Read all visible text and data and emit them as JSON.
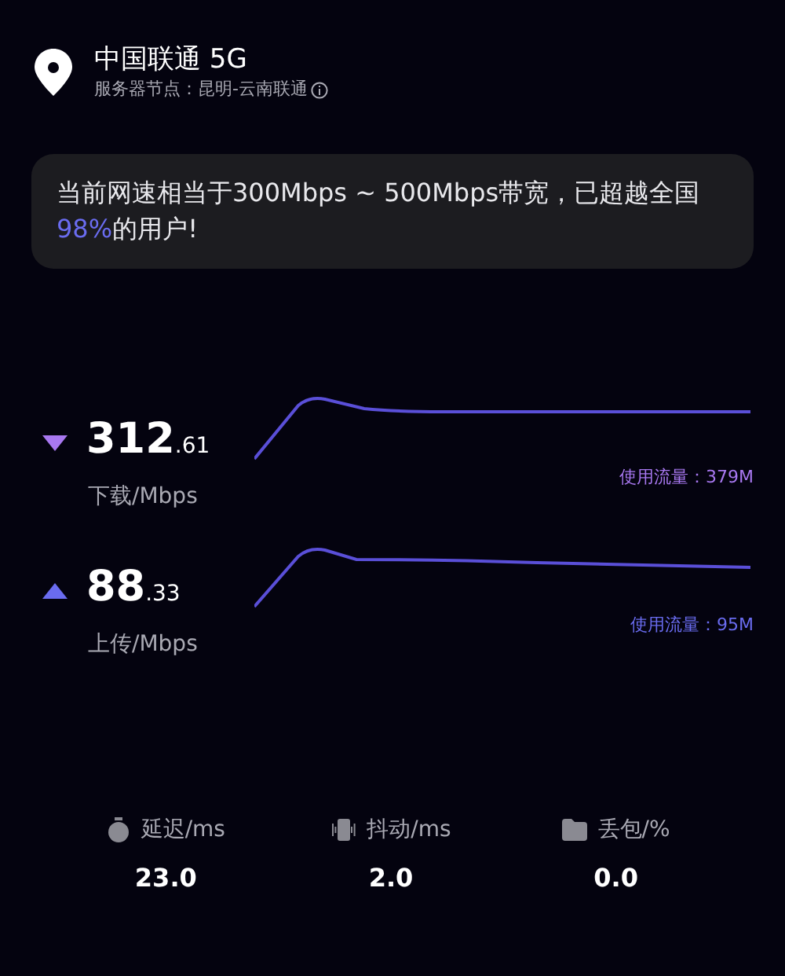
{
  "header": {
    "title": "中国联通 5G",
    "server": "服务器节点：昆明-云南联通"
  },
  "summary": {
    "before": "当前网速相当于300Mbps ~ 500Mbps带宽，已超越全国",
    "highlight": "98%",
    "after": "的用户!"
  },
  "speeds": [
    {
      "kind": "download",
      "integer": "312",
      "decimal": ".61",
      "unit": "下载/Mbps",
      "usage": "使用流量：379M"
    },
    {
      "kind": "upload",
      "integer": "88",
      "decimal": ".33",
      "unit": "上传/Mbps",
      "usage": "使用流量：95M"
    }
  ],
  "metrics": [
    {
      "kind": "latency",
      "label": "延迟/ms",
      "value": "23.0"
    },
    {
      "kind": "jitter",
      "label": "抖动/ms",
      "value": "2.0"
    },
    {
      "kind": "loss",
      "label": "丢包/%",
      "value": "0.0"
    }
  ]
}
